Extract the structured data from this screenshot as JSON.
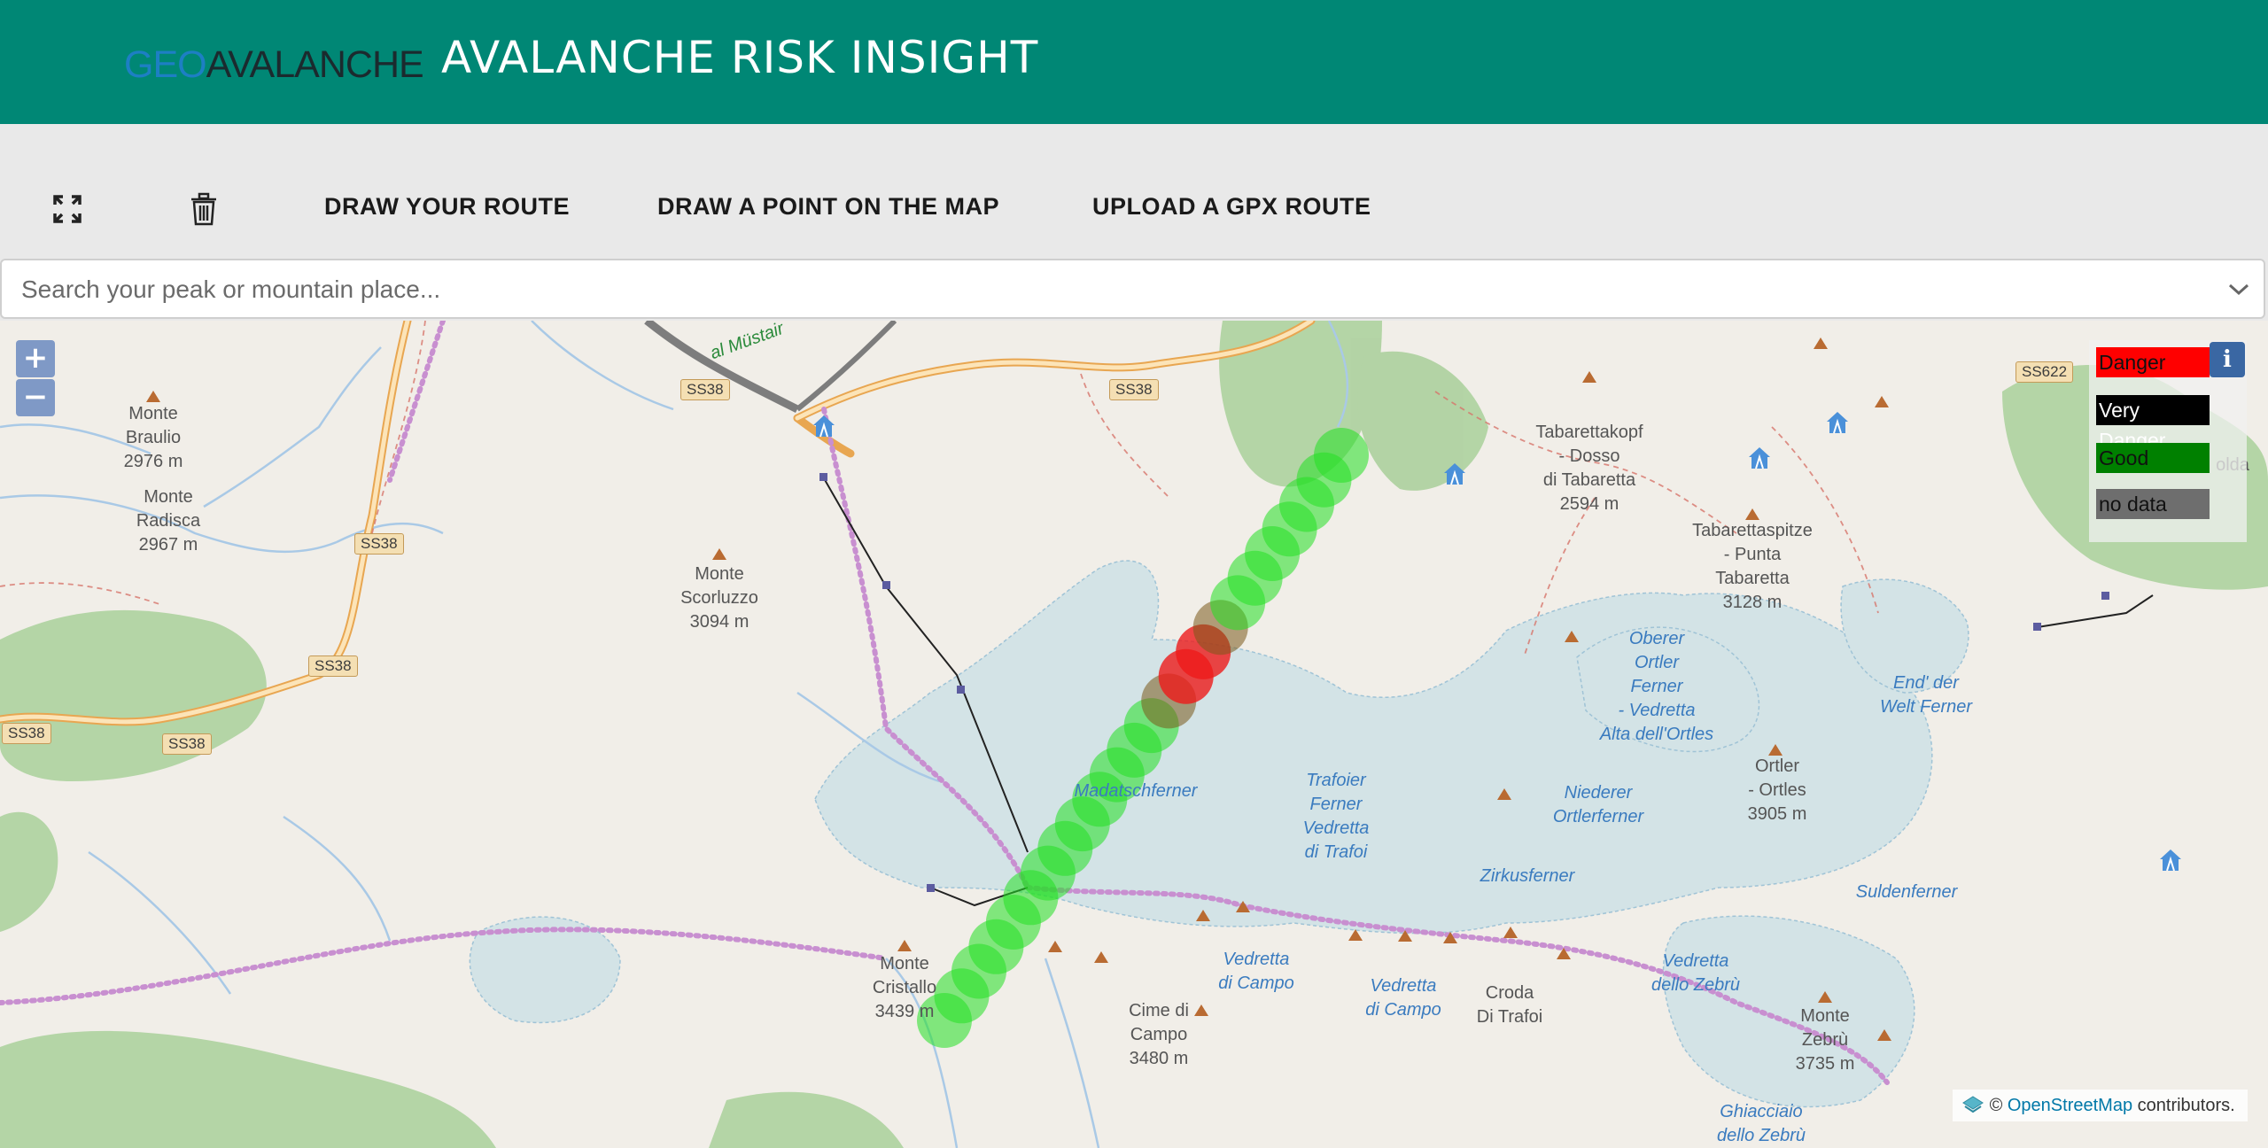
{
  "header": {
    "logo_geo": "GEO",
    "logo_avalanche": "AVALANCHE",
    "title": "AVALANCHE RISK INSIGHT"
  },
  "toolbar": {
    "fullscreen_icon": "fullscreen-icon",
    "delete_icon": "trash-icon",
    "draw_route": "DRAW YOUR ROUTE",
    "draw_point": "DRAW A POINT ON THE MAP",
    "upload_gpx": "UPLOAD A GPX ROUTE"
  },
  "search": {
    "placeholder": "Search your peak or mountain place...",
    "value": ""
  },
  "map": {
    "zoom_in": "+",
    "zoom_out": "−",
    "info": "i",
    "legend": [
      {
        "label": "Danger",
        "color": "#ff0000"
      },
      {
        "label": "Very Danger",
        "color": "#000000"
      },
      {
        "label": "Good",
        "color": "#008000"
      },
      {
        "label": "no data",
        "color": "#6e6e6e"
      }
    ],
    "route_colors": {
      "good": "#22e022",
      "danger": "#ee1a1a"
    },
    "attribution_prefix": "©",
    "attribution_link": "OpenStreetMap",
    "attribution_suffix": "contributors.",
    "labels": {
      "monte_braulio": "Monte\nBraulio\n2976 m",
      "monte_radisca": "Monte\nRadisca\n2967 m",
      "monte_scorluzzo": "Monte\nScorluzzo\n3094 m",
      "tabarettakopf": "Tabarettakopf\n- Dosso\ndi Tabaretta\n2594 m",
      "tabarettaspitze": "Tabarettaspitze\n- Punta\nTabaretta\n3128 m",
      "oberer_ortler": "Oberer\nOrtler\nFerner\n- Vedretta\nAlta dell'Ortles",
      "end_der_welt": "End' der\nWelt Ferner",
      "ortler": "Ortler\n- Ortles\n3905 m",
      "niederer": "Niederer\nOrtlerferner",
      "trafoier": "Trafoier\nFerner\nVedretta\ndi Trafoi",
      "zirkusferner": "Zirkusferner",
      "suldenferner": "Suldenferner",
      "madatschferner": "Madatschferner",
      "monte_cristallo": "Monte\nCristallo\n3439 m",
      "cime_di_campo": "Cime di\nCampo\n3480 m",
      "vedretta_campo1": "Vedretta\ndi Campo",
      "vedretta_campo2": "Vedretta\ndi Campo",
      "croda": "Croda\nDi Trafoi",
      "vedretta_zebru": "Vedretta\ndello Zebrù",
      "monte_zebru": "Monte\nZebrù\n3735 m",
      "ghiacciaio": "Ghiacciaio\ndello Zebrù",
      "mustair": "al Müstair",
      "solda": "olda"
    },
    "shields": [
      "SS38",
      "SS38",
      "SS38",
      "SS38",
      "SS38",
      "SS38",
      "SS622"
    ]
  }
}
